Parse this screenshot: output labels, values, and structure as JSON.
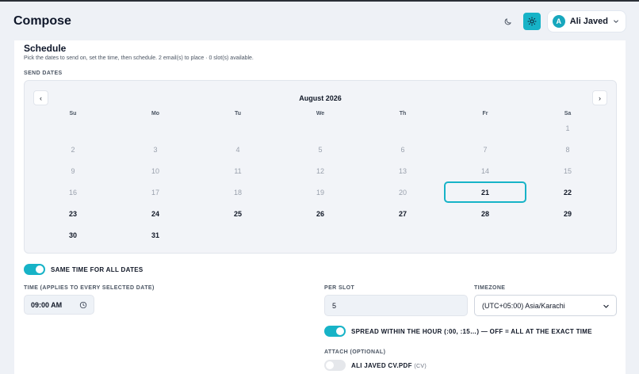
{
  "header": {
    "title": "Compose",
    "moon_icon": "moon-icon",
    "sun_icon": "sun-icon",
    "user": {
      "initial": "A",
      "name": "Ali Javed"
    }
  },
  "schedule": {
    "title": "Schedule",
    "description": "Pick the dates to send on, set the time, then schedule. 2 email(s) to place · 0 slot(s) available.",
    "send_dates_label": "SEND DATES"
  },
  "calendar": {
    "month_label": "August 2026",
    "prev_label": "‹",
    "next_label": "›",
    "weekdays": [
      "Su",
      "Mo",
      "Tu",
      "We",
      "Th",
      "Fr",
      "Sa"
    ],
    "first_weekday_index": 6,
    "days_in_month": 31,
    "today": 21,
    "available_from": 21
  },
  "options": {
    "same_time_label": "SAME TIME FOR ALL DATES",
    "same_time_on": true,
    "time_label": "TIME (APPLIES TO EVERY SELECTED DATE)",
    "time_value": "09:00 AM",
    "per_slot_label": "PER SLOT",
    "per_slot_value": "5",
    "timezone_label": "TIMEZONE",
    "timezone_value": "(UTC+05:00) Asia/Karachi",
    "spread_label": "SPREAD WITHIN THE HOUR (:00, :15…) — OFF = ALL AT THE EXACT TIME",
    "spread_on": true,
    "attach_label": "ATTACH (OPTIONAL)",
    "attachment_name": "ALI JAVED CV.PDF",
    "attachment_tag": "(CV)",
    "attachment_on": false
  },
  "colors": {
    "accent": "#17b3c7",
    "page_bg": "#eef1f6"
  }
}
